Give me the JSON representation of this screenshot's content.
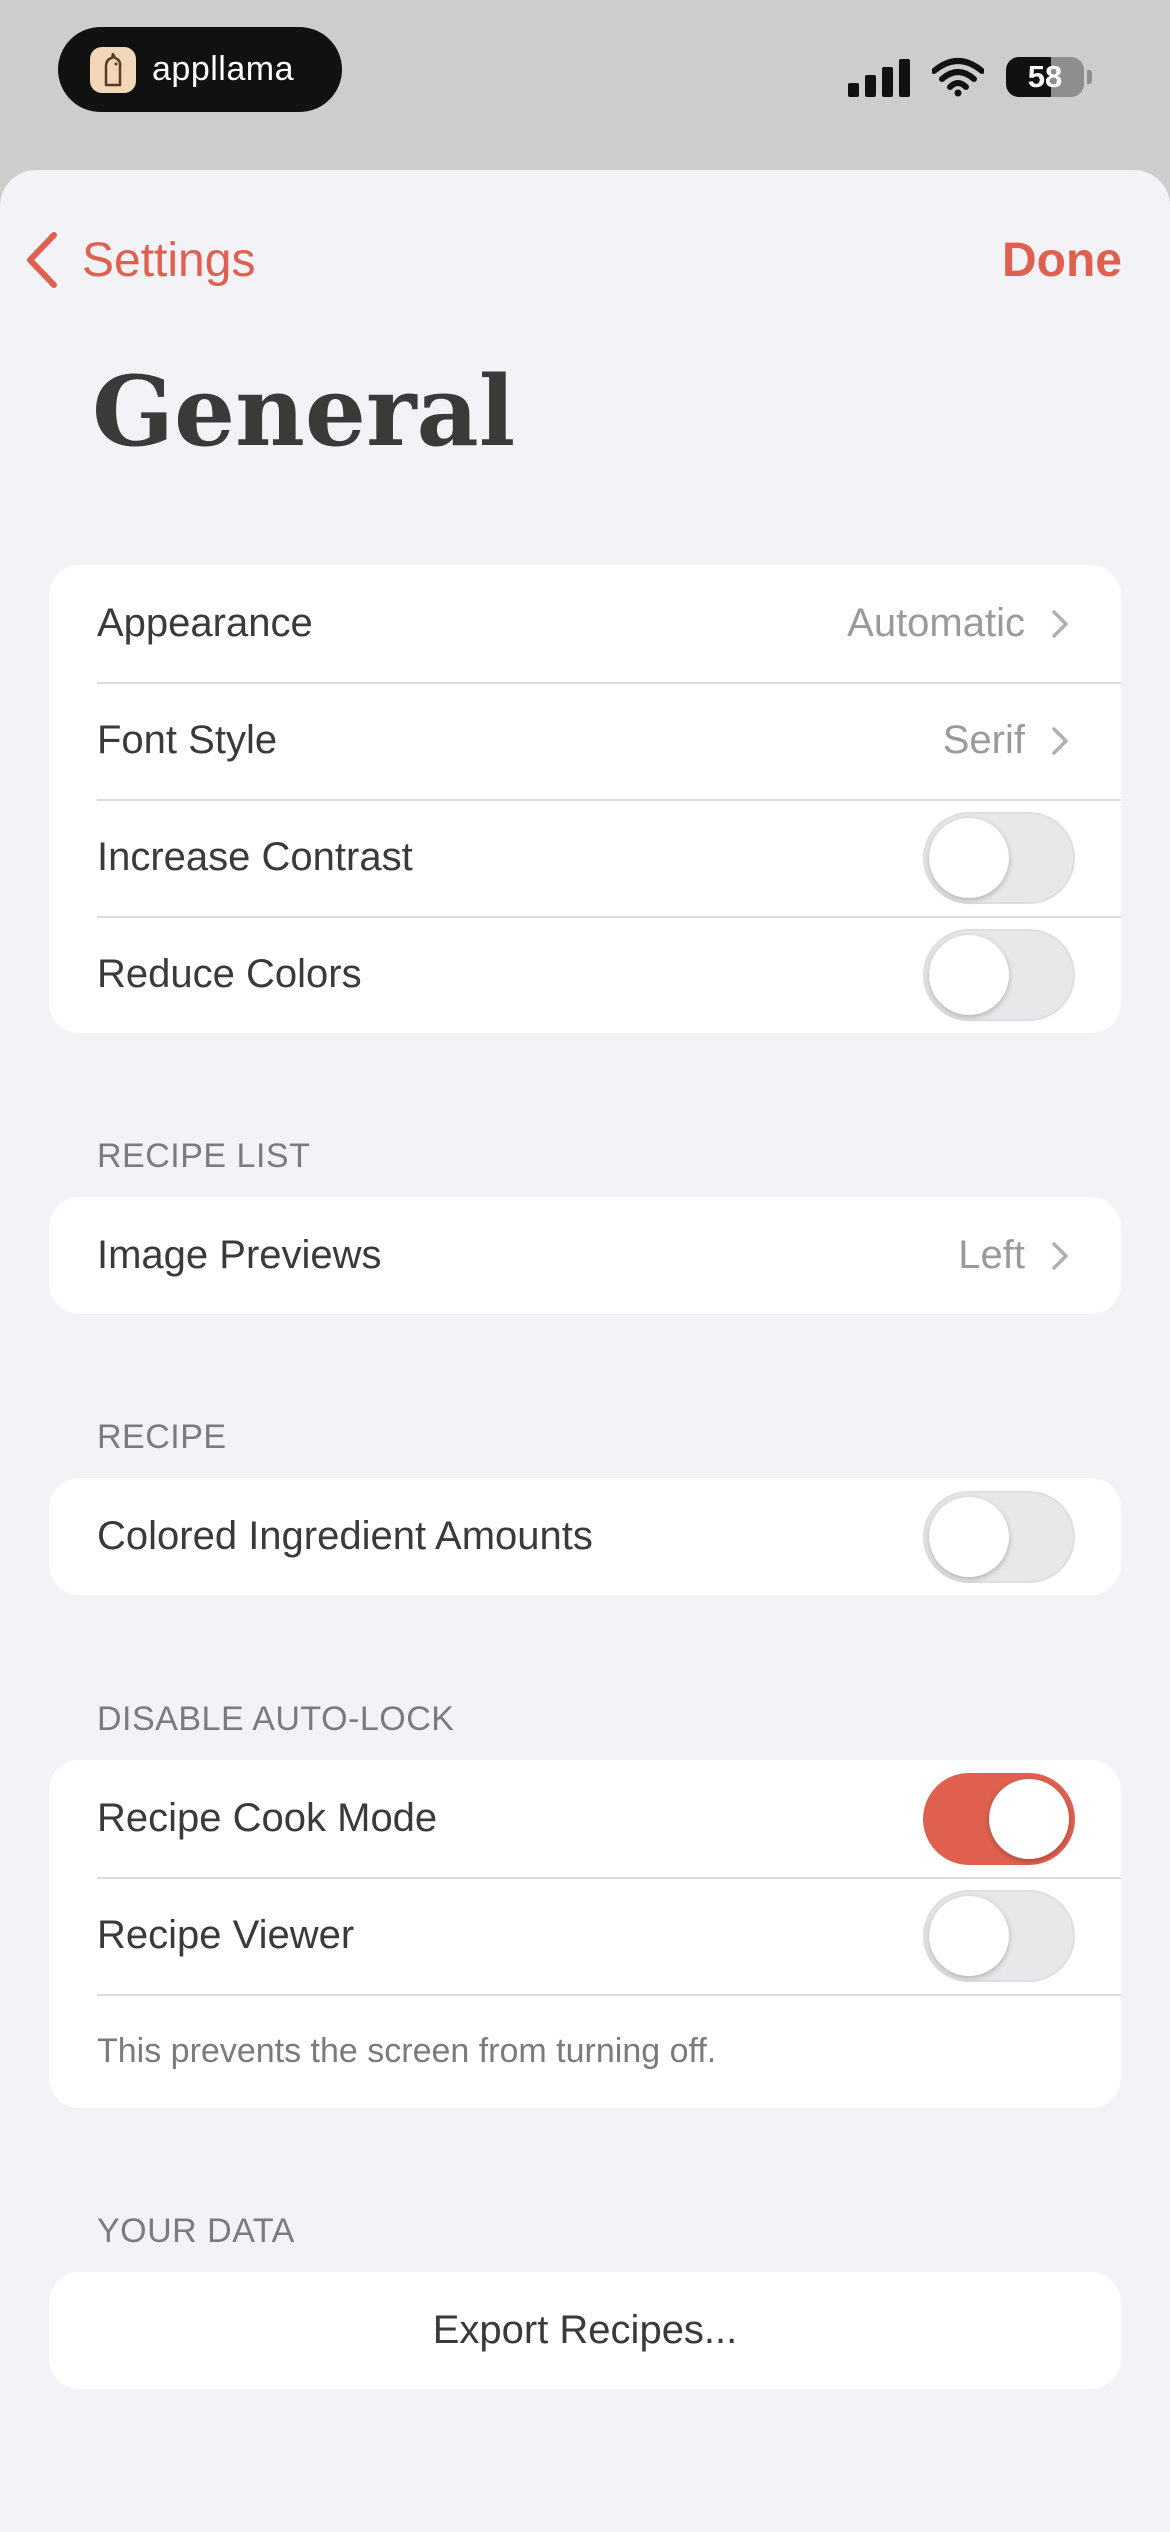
{
  "status_bar": {
    "app_name": "appllama",
    "battery": "58",
    "battery_level": 0.58,
    "icons": [
      "signal-icon",
      "wifi-icon",
      "battery-icon"
    ]
  },
  "nav": {
    "back_label": "Settings",
    "done_label": "Done"
  },
  "page_title": "General",
  "accent_color": "#e0604f",
  "groups": {
    "display": {
      "rows": [
        {
          "label": "Appearance",
          "value": "Automatic"
        },
        {
          "label": "Font Style",
          "value": "Serif"
        },
        {
          "label": "Increase Contrast",
          "toggle": false
        },
        {
          "label": "Reduce Colors",
          "toggle": false
        }
      ]
    },
    "recipe_list": {
      "header": "RECIPE LIST",
      "rows": [
        {
          "label": "Image Previews",
          "value": "Left"
        }
      ]
    },
    "recipe": {
      "header": "RECIPE",
      "rows": [
        {
          "label": "Colored Ingredient Amounts",
          "toggle": false
        }
      ]
    },
    "auto_lock": {
      "header": "DISABLE AUTO-LOCK",
      "rows": [
        {
          "label": "Recipe Cook Mode",
          "toggle": true
        },
        {
          "label": "Recipe Viewer",
          "toggle": false
        }
      ],
      "footer": "This prevents the screen from turning off."
    },
    "your_data": {
      "header": "YOUR DATA",
      "button_label": "Export Recipes..."
    }
  }
}
